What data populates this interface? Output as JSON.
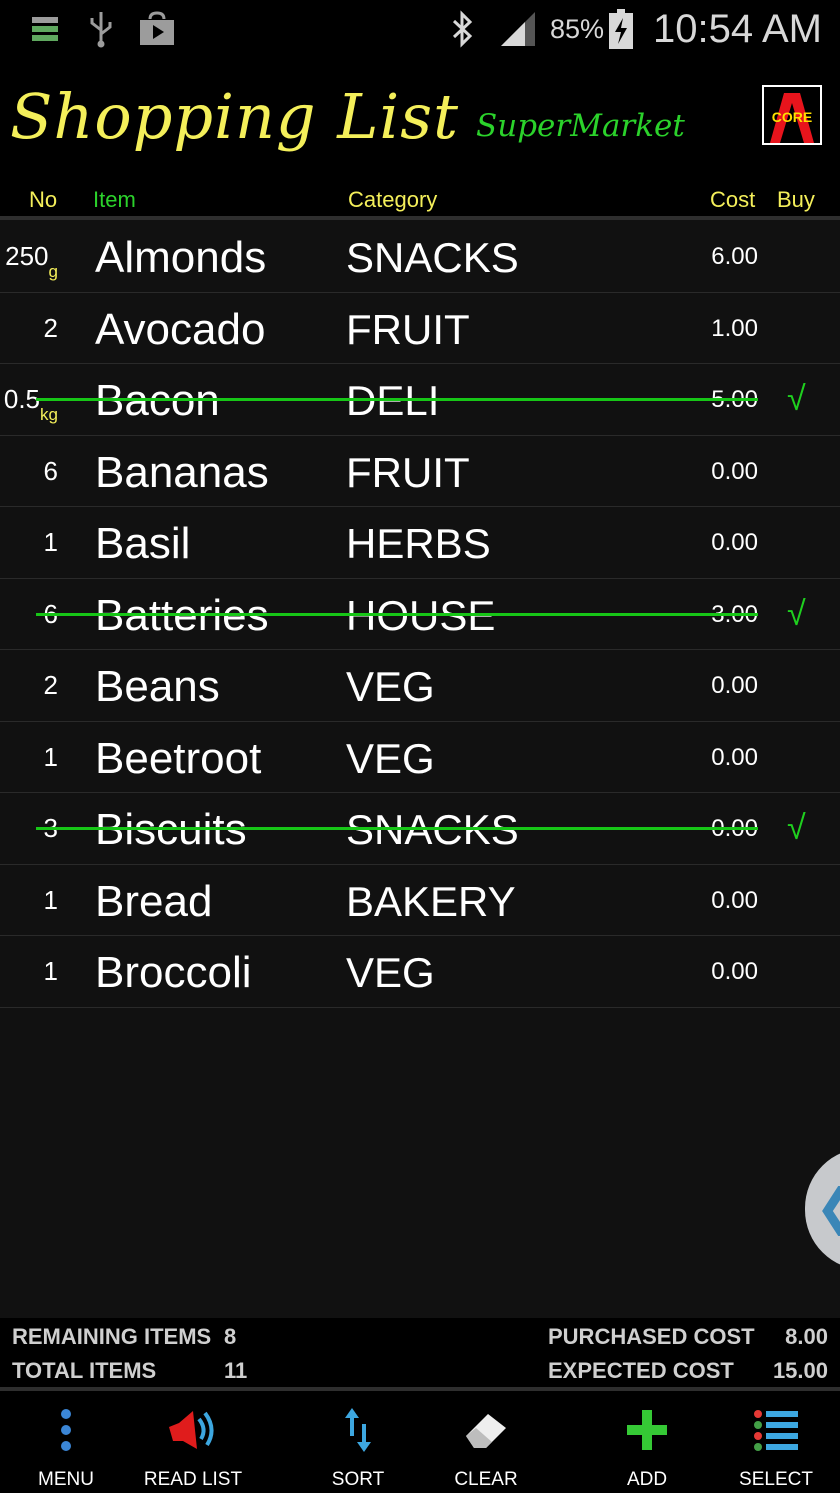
{
  "status_bar": {
    "battery_percent": "85%",
    "time": "10:54 AM",
    "icons": [
      "storage-icon",
      "usb-icon",
      "play-store-icon",
      "bluetooth-icon",
      "signal-icon",
      "battery-charging-icon"
    ]
  },
  "header": {
    "title": "Shopping List",
    "subtitle": "SuperMarket",
    "logo_text": "CORE"
  },
  "columns": {
    "no": "No",
    "item": "Item",
    "category": "Category",
    "cost": "Cost",
    "buy": "Buy"
  },
  "items": [
    {
      "qty": "250",
      "unit": "g",
      "name": "Almonds",
      "category": "SNACKS",
      "cost": "6.00",
      "buy": ""
    },
    {
      "qty": "2",
      "unit": "",
      "name": "Avocado",
      "category": "FRUIT",
      "cost": "1.00",
      "buy": ""
    },
    {
      "qty": "0.5",
      "unit": "kg",
      "name": "Bacon",
      "category": "DELI",
      "cost": "5.00",
      "buy": "√"
    },
    {
      "qty": "6",
      "unit": "",
      "name": "Bananas",
      "category": "FRUIT",
      "cost": "0.00",
      "buy": ""
    },
    {
      "qty": "1",
      "unit": "",
      "name": "Basil",
      "category": "HERBS",
      "cost": "0.00",
      "buy": ""
    },
    {
      "qty": "6",
      "unit": "",
      "name": "Batteries",
      "category": "HOUSE",
      "cost": "3.00",
      "buy": "√"
    },
    {
      "qty": "2",
      "unit": "",
      "name": "Beans",
      "category": "VEG",
      "cost": "0.00",
      "buy": ""
    },
    {
      "qty": "1",
      "unit": "",
      "name": "Beetroot",
      "category": "VEG",
      "cost": "0.00",
      "buy": ""
    },
    {
      "qty": "3",
      "unit": "",
      "name": "Biscuits",
      "category": "SNACKS",
      "cost": "0.00",
      "buy": "√"
    },
    {
      "qty": "1",
      "unit": "",
      "name": "Bread",
      "category": "BAKERY",
      "cost": "0.00",
      "buy": ""
    },
    {
      "qty": "1",
      "unit": "",
      "name": "Broccoli",
      "category": "VEG",
      "cost": "0.00",
      "buy": ""
    }
  ],
  "summary": {
    "remaining_label": "REMAINING ITEMS",
    "remaining_value": "8",
    "total_label": "TOTAL ITEMS",
    "total_value": "11",
    "purchased_label": "PURCHASED COST",
    "purchased_value": "8.00",
    "expected_label": "EXPECTED COST",
    "expected_value": "15.00"
  },
  "toolbar": {
    "menu": "MENU",
    "read_list": "READ LIST",
    "sort": "SORT",
    "clear": "CLEAR",
    "add": "ADD",
    "select": "SELECT"
  },
  "colors": {
    "title": "#f4ef5a",
    "subtitle": "#2bd22b",
    "strike": "#17c617",
    "check": "#1fd01f"
  }
}
